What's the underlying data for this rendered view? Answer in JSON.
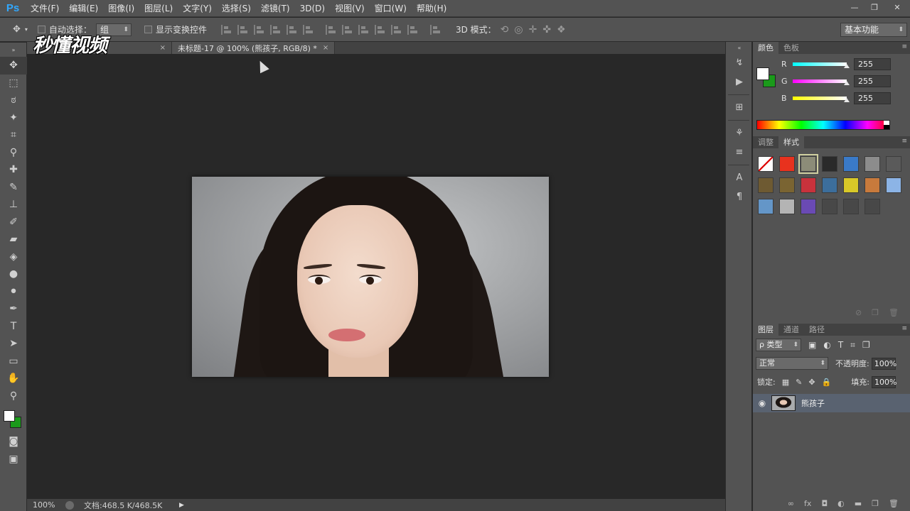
{
  "app": {
    "logo_text": "Ps"
  },
  "menu": [
    "文件(F)",
    "编辑(E)",
    "图像(I)",
    "图层(L)",
    "文字(Y)",
    "选择(S)",
    "滤镜(T)",
    "3D(D)",
    "视图(V)",
    "窗口(W)",
    "帮助(H)"
  ],
  "window_controls": {
    "minimize": "—",
    "restore": "❐",
    "close": "✕"
  },
  "options": {
    "auto_select_label": "自动选择：",
    "auto_select_value": "组",
    "show_transform_label": "显示变换控件",
    "mode_3d_label": "3D 模式：",
    "workspace": "基本功能"
  },
  "logo_watermark": "秒懂视频",
  "document": {
    "tab_title": "未标题-17 @ 100% (熊孩子, RGB/8) *",
    "tab_close": "×"
  },
  "status": {
    "zoom": "100%",
    "doc_size": "文档:468.5 K/468.5K"
  },
  "color_panel": {
    "tabs": [
      "颜色",
      "色板"
    ],
    "channels": [
      {
        "label": "R",
        "value": "255"
      },
      {
        "label": "G",
        "value": "255"
      },
      {
        "label": "B",
        "value": "255"
      }
    ],
    "foreground": "#ffffff",
    "background": "#1a9a1a"
  },
  "styles_panel": {
    "tabs": [
      "调整",
      "样式"
    ],
    "swatches": [
      "#ffffff",
      "#e8321e",
      "#8c8c78",
      "#2a2a2a",
      "#3a7ac8",
      "#8c8c8c",
      "#5a5a5a",
      "#6e5a32",
      "#7a6432",
      "#c8323c",
      "#3c6e9c",
      "#d8c828",
      "#c87a3c",
      "#8cb4e6",
      "#6496c8",
      "#b4b4b4",
      "#6a4ab4",
      "#484848",
      "#484848",
      "#484848"
    ]
  },
  "layers_panel": {
    "tabs": [
      "图层",
      "通道",
      "路径"
    ],
    "kind_filter": "ρ 类型",
    "blend_mode": "正常",
    "opacity_label": "不透明度:",
    "opacity": "100%",
    "lock_label": "锁定:",
    "fill_label": "填充:",
    "fill": "100%",
    "layers": [
      {
        "name": "熊孩子",
        "visible": true
      }
    ]
  }
}
